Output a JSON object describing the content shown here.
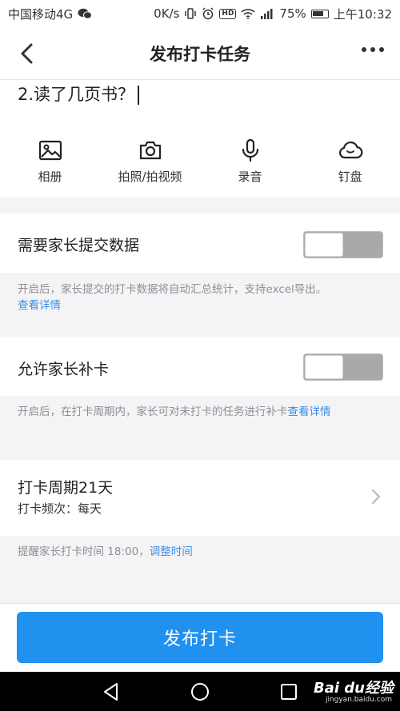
{
  "status_bar": {
    "carrier": "中国移动4G",
    "speed": "0K/s",
    "battery": "75%",
    "time": "上午10:32"
  },
  "header": {
    "title": "发布打卡任务"
  },
  "task": {
    "text": "2.读了几页书？"
  },
  "tools": [
    {
      "label": "相册",
      "icon": "image-icon"
    },
    {
      "label": "拍照/拍视频",
      "icon": "camera-icon"
    },
    {
      "label": "录音",
      "icon": "microphone-icon"
    },
    {
      "label": "钉盘",
      "icon": "cloud-icon"
    }
  ],
  "settings": {
    "submit_data": {
      "label": "需要家长提交数据",
      "enabled": false,
      "hint": "开启后，家长提交的打卡数据将自动汇总统计，支持excel导出。",
      "hint_link": "查看详情"
    },
    "makeup": {
      "label": "允许家长补卡",
      "enabled": false,
      "hint": "开启后，在打卡周期内，家长可对未打卡的任务进行补卡",
      "hint_link": "查看详情"
    }
  },
  "cycle": {
    "title": "打卡周期21天",
    "frequency": "打卡频次：每天"
  },
  "reminder": {
    "text": "提醒家长打卡时间 18:00，",
    "link": "调整时间"
  },
  "footer": {
    "publish_label": "发布打卡"
  },
  "watermark": {
    "brand": "Bai du经验",
    "url": "jingyan.baidu.com"
  },
  "colors": {
    "accent": "#2191f0",
    "link": "#3a8ee6"
  }
}
